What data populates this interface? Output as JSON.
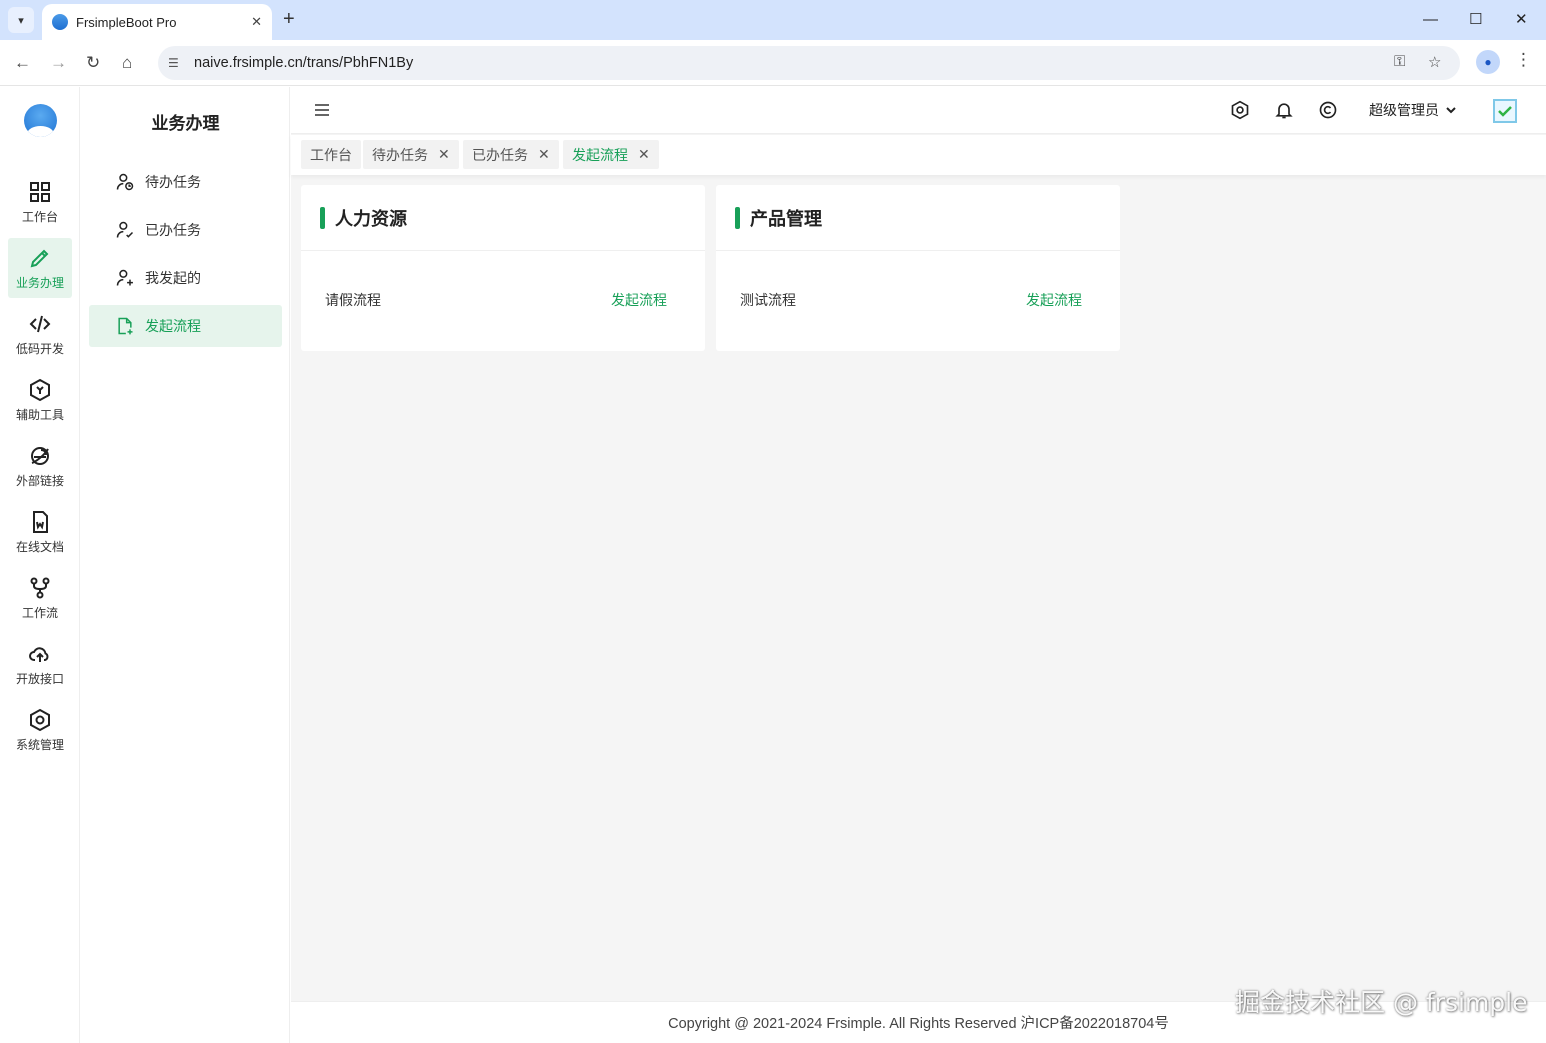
{
  "browser": {
    "tab_title": "FrsimpleBoot Pro",
    "url": "naive.frsimple.cn/trans/PbhFN1By"
  },
  "rail": {
    "items": [
      {
        "label": "工作台",
        "icon": "dashboard-icon"
      },
      {
        "label": "业务办理",
        "icon": "pencil-icon",
        "active": true
      },
      {
        "label": "低码开发",
        "icon": "code-icon"
      },
      {
        "label": "辅助工具",
        "icon": "hexagon-tool-icon"
      },
      {
        "label": "外部链接",
        "icon": "browser-link-icon"
      },
      {
        "label": "在线文档",
        "icon": "document-icon"
      },
      {
        "label": "工作流",
        "icon": "workflow-icon"
      },
      {
        "label": "开放接口",
        "icon": "cloud-upload-icon"
      },
      {
        "label": "系统管理",
        "icon": "settings-hex-icon"
      }
    ]
  },
  "submenu": {
    "title": "业务办理",
    "items": [
      {
        "label": "待办任务",
        "icon": "user-pending-icon"
      },
      {
        "label": "已办任务",
        "icon": "user-check-icon"
      },
      {
        "label": "我发起的",
        "icon": "user-add-icon"
      },
      {
        "label": "发起流程",
        "icon": "file-add-icon",
        "active": true
      }
    ]
  },
  "header": {
    "user": "超级管理员"
  },
  "tags": [
    {
      "label": "工作台",
      "closable": false
    },
    {
      "label": "待办任务",
      "closable": true
    },
    {
      "label": "已办任务",
      "closable": true
    },
    {
      "label": "发起流程",
      "closable": true,
      "active": true
    }
  ],
  "cards": [
    {
      "title": "人力资源",
      "process": "请假流程",
      "action": "发起流程"
    },
    {
      "title": "产品管理",
      "process": "测试流程",
      "action": "发起流程"
    }
  ],
  "footer": {
    "text": "Copyright @ 2021-2024 Frsimple. All Rights Reserved 沪ICP备2022018704号"
  },
  "watermark": "掘金技术社区 @ frsimple",
  "colors": {
    "accent": "#18a058",
    "accent_bg": "#e6f4ec",
    "chrome_tabstrip": "#d3e3fd"
  }
}
